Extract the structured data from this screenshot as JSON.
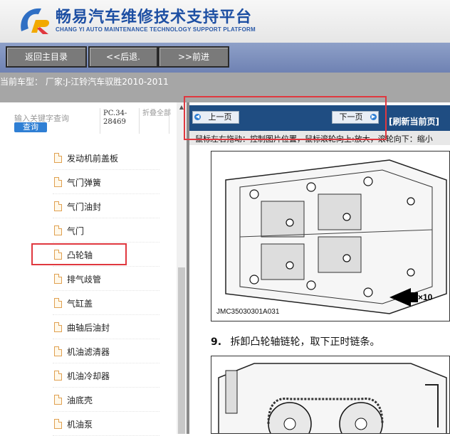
{
  "header": {
    "title": "畅易汽车维修技术支持平台",
    "subtitle": "CHANG YI AUTO MAINTENANCE TECHNOLOGY SUPPORT PLATFORM"
  },
  "toolbar": {
    "home_label": "返回主目录",
    "back_label": "<<后退.",
    "forward_label": ">>前进"
  },
  "model_bar": {
    "text": "当前车型： 厂家:J-江铃汽车驭胜2010-2011"
  },
  "search": {
    "placeholder": "输入关键字查询",
    "button": "查询",
    "code": "PC.34-28469",
    "fold": "折叠全部"
  },
  "tree": {
    "items": [
      "发动机前盖板",
      "气门弹簧",
      "气门油封",
      "气门",
      "凸轮轴",
      "排气歧管",
      "气缸盖",
      "曲轴后油封",
      "机油滤清器",
      "机油冷却器",
      "油底壳",
      "机油泵"
    ],
    "highlighted": "凸轮轴"
  },
  "viewer": {
    "prev_label": "上一页",
    "next_label": "下一页",
    "refresh_label": "[刷新当前页]",
    "hint": "鼠标左右拖动：控制图片位置，鼠标滚轮向上:放大，滚轮向下：缩小",
    "figure_code": "JMC35030301A031",
    "callout": "×10",
    "step_number": "9.",
    "step_text": "拆卸凸轮轴链轮，取下正时链条。"
  },
  "colors": {
    "header_blue": "#1d4fa3",
    "toolbar": "#6f82b3",
    "nav_dark": "#1f4d82",
    "highlight_red": "#e0383f"
  }
}
